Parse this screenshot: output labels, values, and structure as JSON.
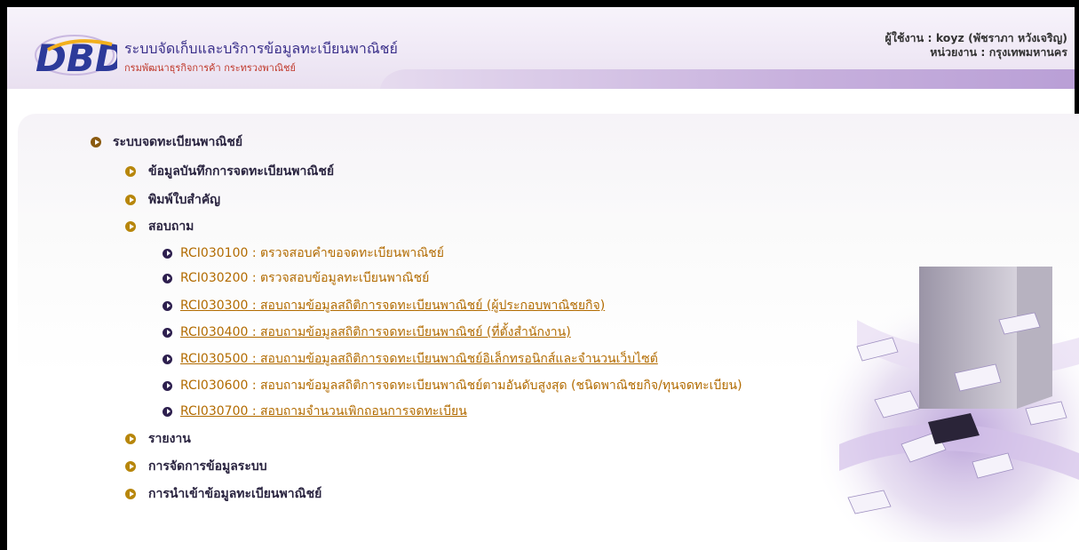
{
  "header": {
    "logo_text": "DBD",
    "system_title": "ระบบจัดเก็บและบริการข้อมูลทะเบียนพาณิชย์",
    "department": "กรมพัฒนาธุรกิจการค้า กระทรวงพาณิชย์",
    "user_line": "ผู้ใช้งาน : koyz (พัชราภา หวังเจริญ)",
    "unit_line": "หน่วยงาน : กรุงเทพมหานคร"
  },
  "menu": {
    "root": "ระบบจดทะเบียนพาณิชย์",
    "items": [
      "ข้อมูลบันทึกการจดทะเบียนพาณิชย์",
      "พิมพ์ใบสำคัญ",
      "สอบถาม"
    ],
    "inquiry": [
      "RCI030100 : ตรวจสอบคำขอจดทะเบียนพาณิชย์",
      "RCI030200 : ตรวจสอบข้อมูลทะเบียนพาณิชย์",
      "RCI030300 : สอบถามข้อมูลสถิติการจดทะเบียนพาณิชย์ (ผู้ประกอบพาณิชยกิจ)",
      "RCI030400 : สอบถามข้อมูลสถิติการจดทะเบียนพาณิชย์ (ที่ตั้งสำนักงาน)",
      "RCI030500 : สอบถามข้อมูลสถิติการจดทะเบียนพาณิชย์อิเล็กทรอนิกส์และจำนวนเว็บไซต์",
      "RCI030600 : สอบถามข้อมูลสถิติการจดทะเบียนพาณิชย์ตามอันดับสูงสุด (ชนิดพาณิชยกิจ/ทุนจดทะเบียน)",
      "RCI030700 : สอบถามจำนวนเพิกถอนการจดทะเบียน"
    ],
    "after": [
      "รายงาน",
      "การจัดการข้อมูลระบบ",
      "การนำเข้าข้อมูลทะเบียนพาณิชย์"
    ]
  },
  "colors": {
    "brand_purple": "#3a2f8a",
    "link_orange": "#b26b00",
    "dept_red": "#c0392b"
  }
}
